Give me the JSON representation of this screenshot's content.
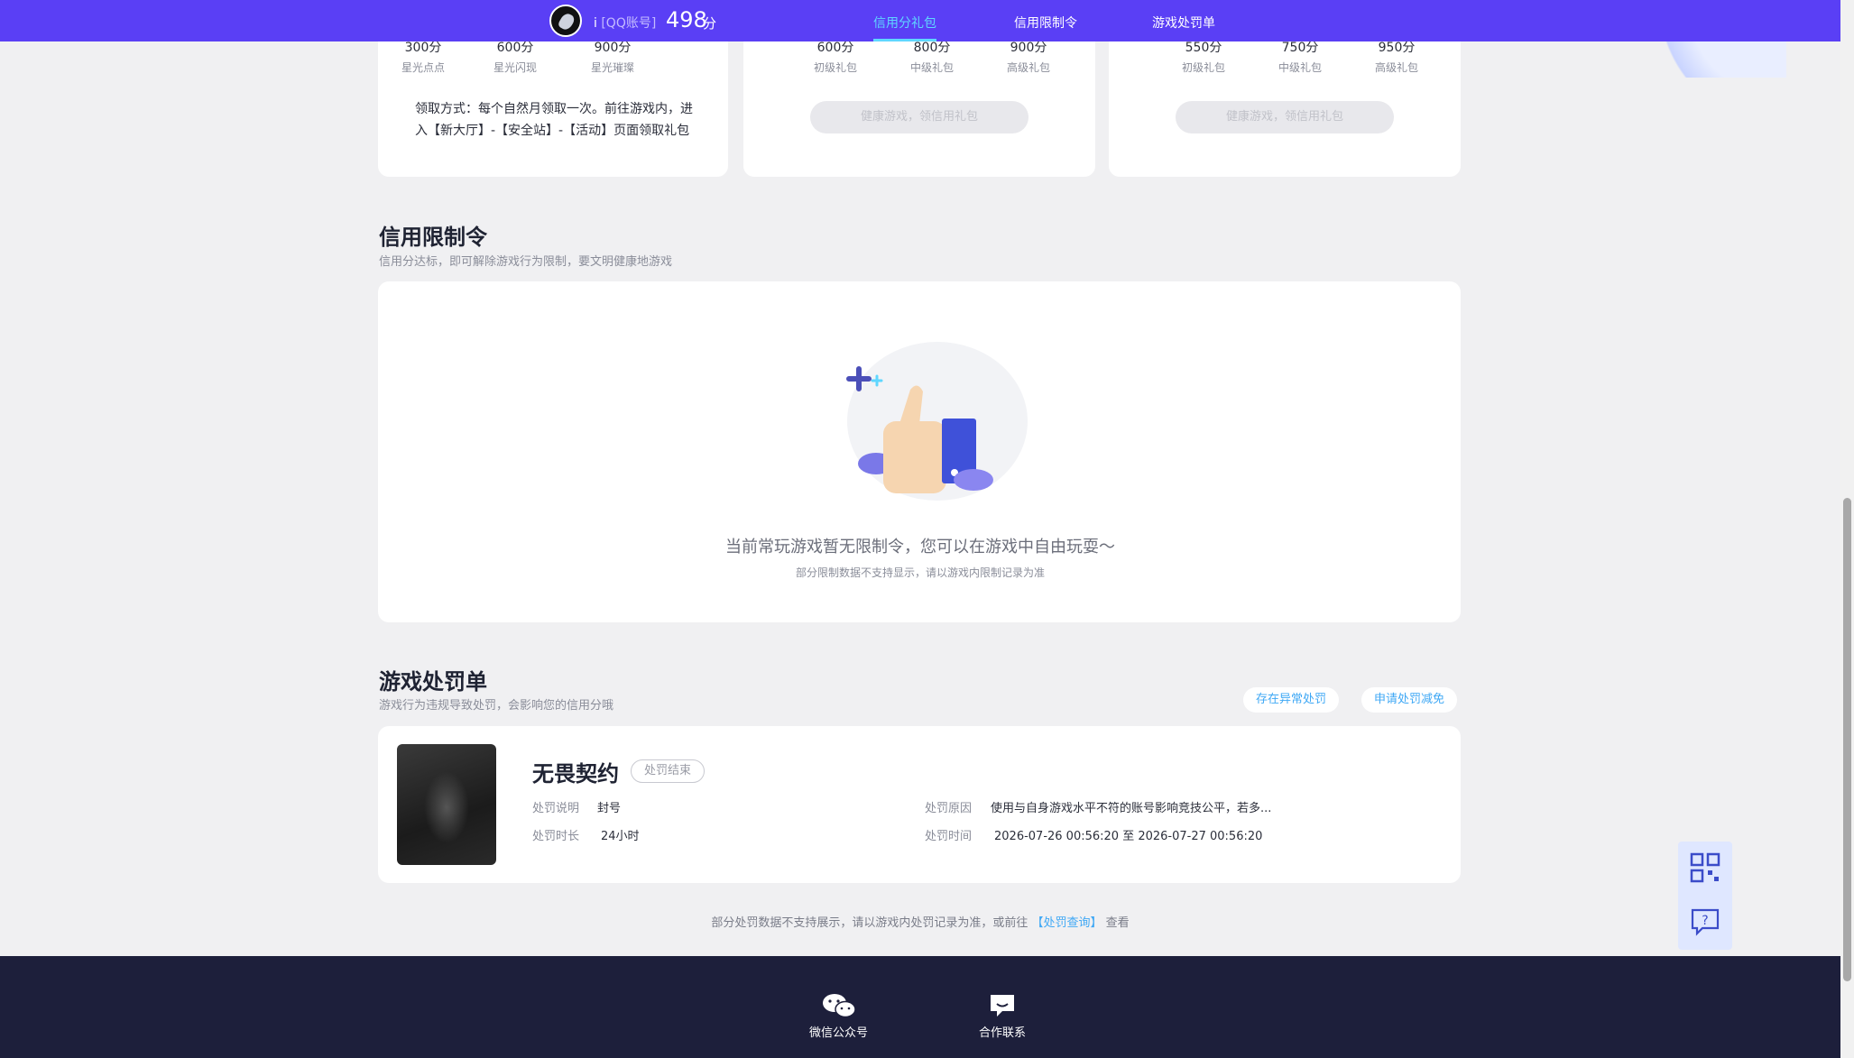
{
  "nav": {
    "user_name": "i",
    "account_type": "[QQ账号]",
    "score": "498",
    "score_unit": "分",
    "tabs": [
      {
        "label": "信用分礼包",
        "active": true
      },
      {
        "label": "信用限制令",
        "active": false
      },
      {
        "label": "游戏处罚单",
        "active": false
      }
    ]
  },
  "gift_cards": [
    {
      "tiers": [
        {
          "value": "300分",
          "label": "星光点点"
        },
        {
          "value": "600分",
          "label": "星光闪现"
        },
        {
          "value": "900分",
          "label": "星光璀璨"
        }
      ],
      "claim_text": "领取方式：每个自然月领取一次。前往游戏内，进入【新大厅】-【安全站】-【活动】页面领取礼包"
    },
    {
      "tiers": [
        {
          "value": "600分",
          "label": "初级礼包"
        },
        {
          "value": "800分",
          "label": "中级礼包"
        },
        {
          "value": "900分",
          "label": "高级礼包"
        }
      ],
      "button": "健康游戏，领信用礼包"
    },
    {
      "tiers": [
        {
          "value": "550分",
          "label": "初级礼包"
        },
        {
          "value": "750分",
          "label": "中级礼包"
        },
        {
          "value": "950分",
          "label": "高级礼包"
        }
      ],
      "button": "健康游戏，领信用礼包"
    }
  ],
  "restriction": {
    "title": "信用限制令",
    "subtitle": "信用分达标，即可解除游戏行为限制，要文明健康地游戏",
    "empty_message": "当前常玩游戏暂无限制令，您可以在游戏中自由玩耍～",
    "empty_note": "部分限制数据不支持显示，请以游戏内限制记录为准"
  },
  "penalty": {
    "title": "游戏处罚单",
    "subtitle": "游戏行为违规导致处罚，会影响您的信用分哦",
    "btn_abnormal": "存在异常处罚",
    "btn_appeal": "申请处罚减免",
    "item": {
      "game_name": "无畏契约",
      "status": "处罚结束",
      "desc_label": "处罚说明",
      "desc_value": "封号",
      "duration_label": "处罚时长",
      "duration_value": "24小时",
      "reason_label": "处罚原因",
      "reason_value": "使用与自身游戏水平不符的账号影响竞技公平，若多...",
      "time_label": "处罚时间",
      "time_value": "2026-07-26 00:56:20 至 2026-07-27 00:56:20"
    },
    "bottom_note_prefix": "部分处罚数据不支持展示，请以游戏内处罚记录为准，或前往",
    "bottom_note_link": "【处罚查询】",
    "bottom_note_suffix": "查看"
  },
  "footer": {
    "wechat_label": "微信公众号",
    "contact_label": "合作联系"
  },
  "colors": {
    "nav_bg": "#5a3ff5",
    "accent": "#5fd7ff",
    "link": "#3fa8f5",
    "footer_bg": "#1d1f3b"
  }
}
